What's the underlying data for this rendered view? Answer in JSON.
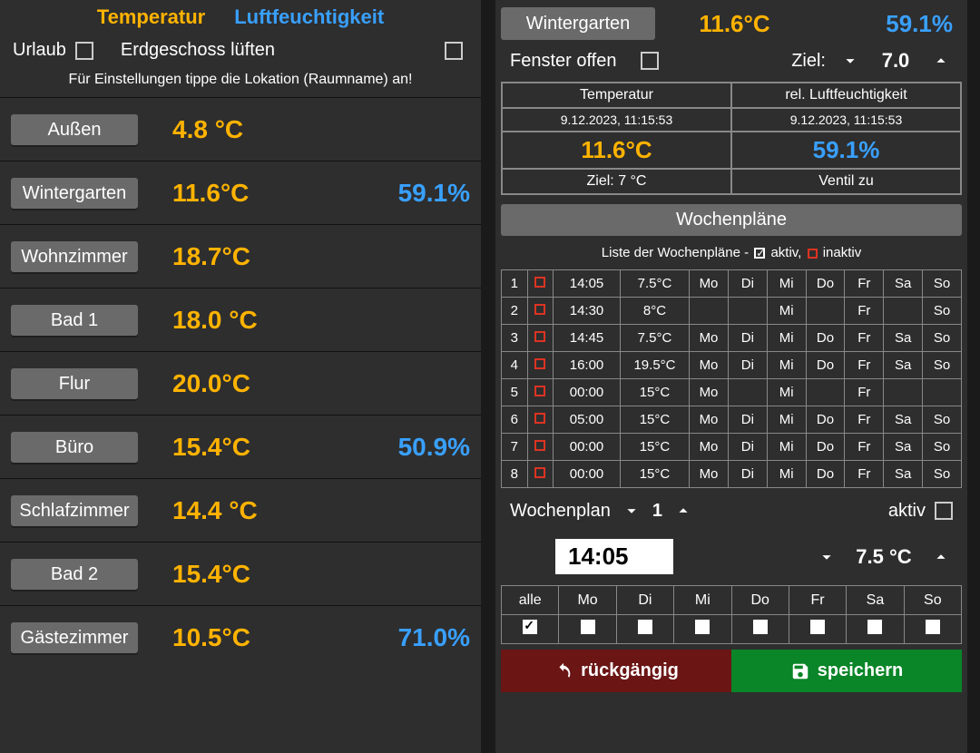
{
  "left": {
    "tab_temp": "Temperatur",
    "tab_hum": "Luftfeuchtigkeit",
    "opt_vacation": "Urlaub",
    "opt_ventilate": "Erdgeschoss lüften",
    "hint": "Für Einstellungen tippe die Lokation (Raumname) an!",
    "rooms": [
      {
        "name": "Außen",
        "temp": "4.8 °C",
        "hum": ""
      },
      {
        "name": "Wintergarten",
        "temp": "11.6°C",
        "hum": "59.1%"
      },
      {
        "name": "Wohnzimmer",
        "temp": "18.7°C",
        "hum": ""
      },
      {
        "name": "Bad 1",
        "temp": "18.0 °C",
        "hum": ""
      },
      {
        "name": "Flur",
        "temp": "20.0°C",
        "hum": ""
      },
      {
        "name": "Büro",
        "temp": "15.4°C",
        "hum": "50.9%"
      },
      {
        "name": "Schlafzimmer",
        "temp": "14.4 °C",
        "hum": ""
      },
      {
        "name": "Bad 2",
        "temp": "15.4°C",
        "hum": ""
      },
      {
        "name": "Gästezimmer",
        "temp": "10.5°C",
        "hum": "71.0%"
      }
    ]
  },
  "right": {
    "room_btn": "Wintergarten",
    "temp": "11.6°C",
    "hum": "59.1%",
    "window_open_label": "Fenster offen",
    "target_label": "Ziel:",
    "target_value": "7.0",
    "info": {
      "temp_hdr": "Temperatur",
      "hum_hdr": "rel. Luftfeuchtigkeit",
      "timestamp": "9.12.2023, 11:15:53",
      "temp_val": "11.6°C",
      "hum_val": "59.1%",
      "target_sub": "Ziel: 7 °C",
      "valve_sub": "Ventil zu"
    },
    "weekplans_btn": "Wochenpläne",
    "wp_caption_prefix": "Liste der Wochenpläne - ",
    "wp_caption_active": "aktiv,",
    "wp_caption_inactive": "inaktiv",
    "plans": [
      {
        "idx": "1",
        "active": false,
        "time": "14:05",
        "temp": "7.5°C",
        "days": [
          "Mo",
          "Di",
          "Mi",
          "Do",
          "Fr",
          "Sa",
          "So"
        ]
      },
      {
        "idx": "2",
        "active": false,
        "time": "14:30",
        "temp": "8°C",
        "days": [
          "",
          "",
          "Mi",
          "",
          "Fr",
          "",
          "So"
        ]
      },
      {
        "idx": "3",
        "active": false,
        "time": "14:45",
        "temp": "7.5°C",
        "days": [
          "Mo",
          "Di",
          "Mi",
          "Do",
          "Fr",
          "Sa",
          "So"
        ]
      },
      {
        "idx": "4",
        "active": false,
        "time": "16:00",
        "temp": "19.5°C",
        "days": [
          "Mo",
          "Di",
          "Mi",
          "Do",
          "Fr",
          "Sa",
          "So"
        ]
      },
      {
        "idx": "5",
        "active": false,
        "time": "00:00",
        "temp": "15°C",
        "days": [
          "Mo",
          "",
          "Mi",
          "",
          "Fr",
          "",
          ""
        ]
      },
      {
        "idx": "6",
        "active": false,
        "time": "05:00",
        "temp": "15°C",
        "days": [
          "Mo",
          "Di",
          "Mi",
          "Do",
          "Fr",
          "Sa",
          "So"
        ]
      },
      {
        "idx": "7",
        "active": false,
        "time": "00:00",
        "temp": "15°C",
        "days": [
          "Mo",
          "Di",
          "Mi",
          "Do",
          "Fr",
          "Sa",
          "So"
        ]
      },
      {
        "idx": "8",
        "active": false,
        "time": "00:00",
        "temp": "15°C",
        "days": [
          "Mo",
          "Di",
          "Mi",
          "Do",
          "Fr",
          "Sa",
          "So"
        ]
      }
    ],
    "edit": {
      "wp_label": "Wochenplan",
      "wp_number": "1",
      "active_label": "aktiv",
      "time_value": "14:05",
      "temp_value": "7.5 °C",
      "day_headers": [
        "alle",
        "Mo",
        "Di",
        "Mi",
        "Do",
        "Fr",
        "Sa",
        "So"
      ],
      "days_checked": [
        true,
        false,
        false,
        false,
        false,
        false,
        false,
        false
      ]
    },
    "undo_btn": "rückgängig",
    "save_btn": "speichern"
  }
}
